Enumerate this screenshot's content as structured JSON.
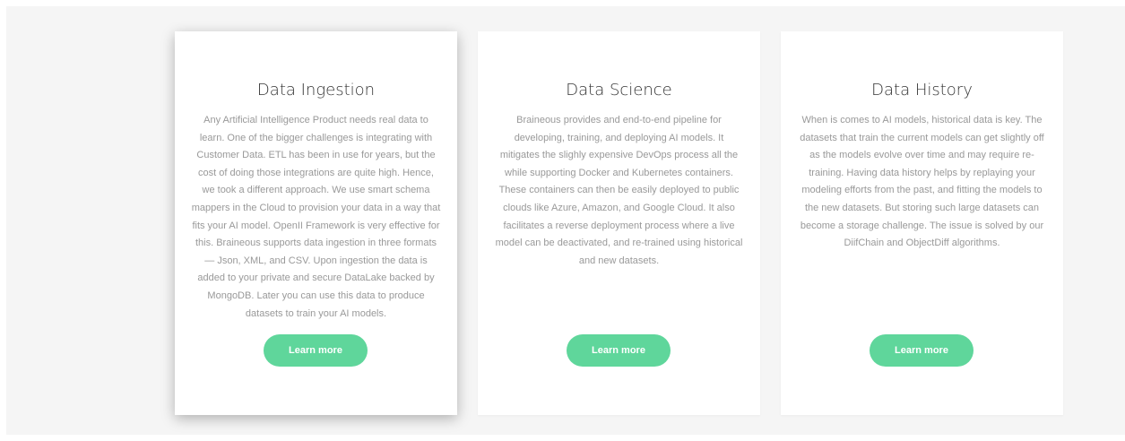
{
  "colors": {
    "section_background": "#f5f5f5",
    "card_background": "#ffffff",
    "button": "#5fd69b",
    "title_text": "#333333",
    "body_text": "#999999"
  },
  "cards": [
    {
      "title": "Data Ingestion",
      "body": "Any Artificial Intelligence Product needs real data to learn. One of the bigger challenges is integrating with Customer Data. ETL has been in use for years, but the cost of doing those integrations are quite high. Hence, we took a different approach. We use smart schema mappers in the Cloud to provision your data in a way that fits your AI model. OpenII Framework is very effective for this. Braineous supports data ingestion in three formats — Json, XML, and CSV. Upon ingestion the data is added to your private and secure DataLake backed by MongoDB. Later you can use this data to produce datasets to train your AI models.",
      "button_label": "Learn more"
    },
    {
      "title": "Data Science",
      "body": "Braineous provides and end-to-end pipeline for developing, training, and deploying AI models. It mitigates the slighly expensive DevOps process all the while supporting Docker and Kubernetes containers. These containers can then be easily deployed to public clouds like Azure, Amazon, and Google Cloud. It also facilitates a reverse deployment process where a live model can be deactivated, and re-trained using historical and new datasets.",
      "button_label": "Learn more"
    },
    {
      "title": "Data History",
      "body": "When is comes to AI models, historical data is key. The datasets that train the current models can get slightly off as the models evolve over time and may require re-training. Having data history helps by replaying your modeling efforts from the past, and fitting the models to the new datasets. But storing such large datasets can become a storage challenge. The issue is solved by our DiifChain and ObjectDiff algorithms.",
      "button_label": "Learn more"
    }
  ]
}
